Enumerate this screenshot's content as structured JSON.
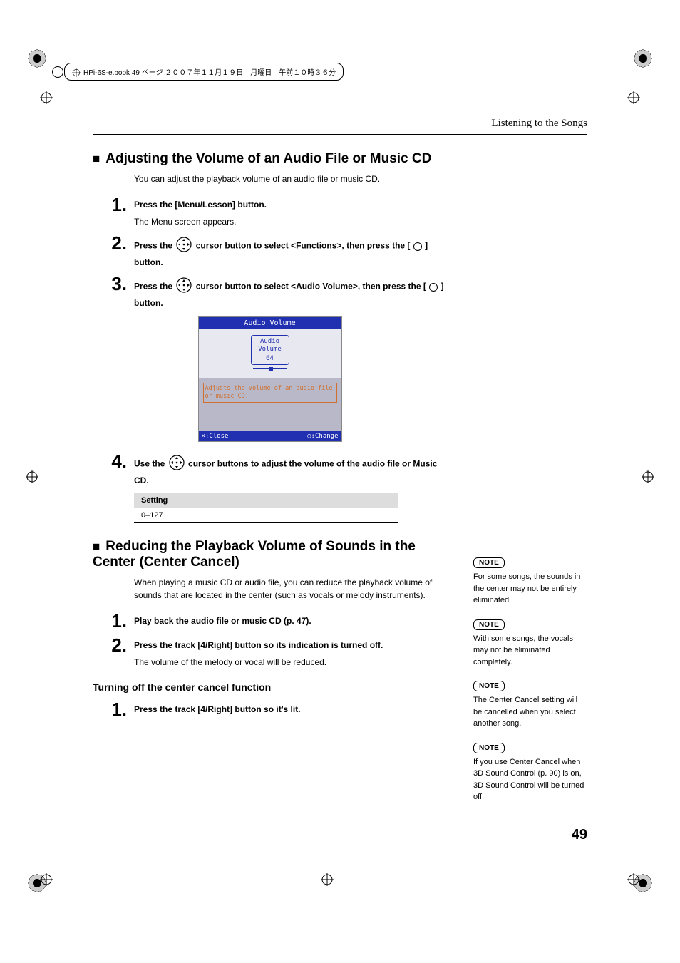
{
  "meta_header": "HPi-6S-e.book  49 ページ  ２００７年１１月１９日　月曜日　午前１０時３６分",
  "page_header": "Listening to the Songs",
  "section1": {
    "title": "Adjusting the Volume of an Audio File or Music CD",
    "intro": "You can adjust the playback volume of an audio file or music CD.",
    "steps": [
      {
        "num": "1.",
        "bold": "Press the [Menu/Lesson] button.",
        "plain": "The Menu screen appears."
      },
      {
        "num": "2.",
        "bold_pre": "Press the ",
        "bold_mid": " cursor button to select <Functions>, then press the [ ",
        "bold_post": " ] button."
      },
      {
        "num": "3.",
        "bold_pre": "Press the ",
        "bold_mid": " cursor button to select <Audio Volume>, then press the [ ",
        "bold_post": " ] button."
      },
      {
        "num": "4.",
        "bold_pre": "Use the ",
        "bold_mid": " cursor buttons to adjust the volume of the audio file or Music CD."
      }
    ],
    "screenshot": {
      "title": "Audio Volume",
      "box_label1": "Audio",
      "box_label2": "Volume",
      "box_value": "64",
      "description": "Adjusts the volume of an audio file or music CD.",
      "footer_left": "×:Close",
      "footer_right": "○:Change"
    },
    "table": {
      "header": "Setting",
      "value": "0–127"
    }
  },
  "section2": {
    "title": "Reducing the Playback Volume of Sounds in the Center (Center Cancel)",
    "intro": "When playing a music CD or audio file, you can reduce the playback volume of sounds that are located in the center (such as vocals or melody instruments).",
    "steps": [
      {
        "num": "1.",
        "bold": "Play back the audio file or music CD (p. 47)."
      },
      {
        "num": "2.",
        "bold": "Press the track [4/Right] button so its indication is turned off.",
        "plain": "The volume of the melody or vocal will be reduced."
      }
    ],
    "sub_title": "Turning off the center cancel function",
    "sub_steps": [
      {
        "num": "1.",
        "bold": "Press the track [4/Right] button so it's lit."
      }
    ]
  },
  "notes": [
    {
      "label": "NOTE",
      "text": "For some songs, the sounds in the center may not be entirely eliminated."
    },
    {
      "label": "NOTE",
      "text": "With some songs, the vocals may not be eliminated completely."
    },
    {
      "label": "NOTE",
      "text": "The Center Cancel setting will be cancelled when you select another song."
    },
    {
      "label": "NOTE",
      "text": "If you use Center Cancel when 3D Sound Control (p. 90) is on, 3D Sound Control will be turned off."
    }
  ],
  "page_number": "49"
}
